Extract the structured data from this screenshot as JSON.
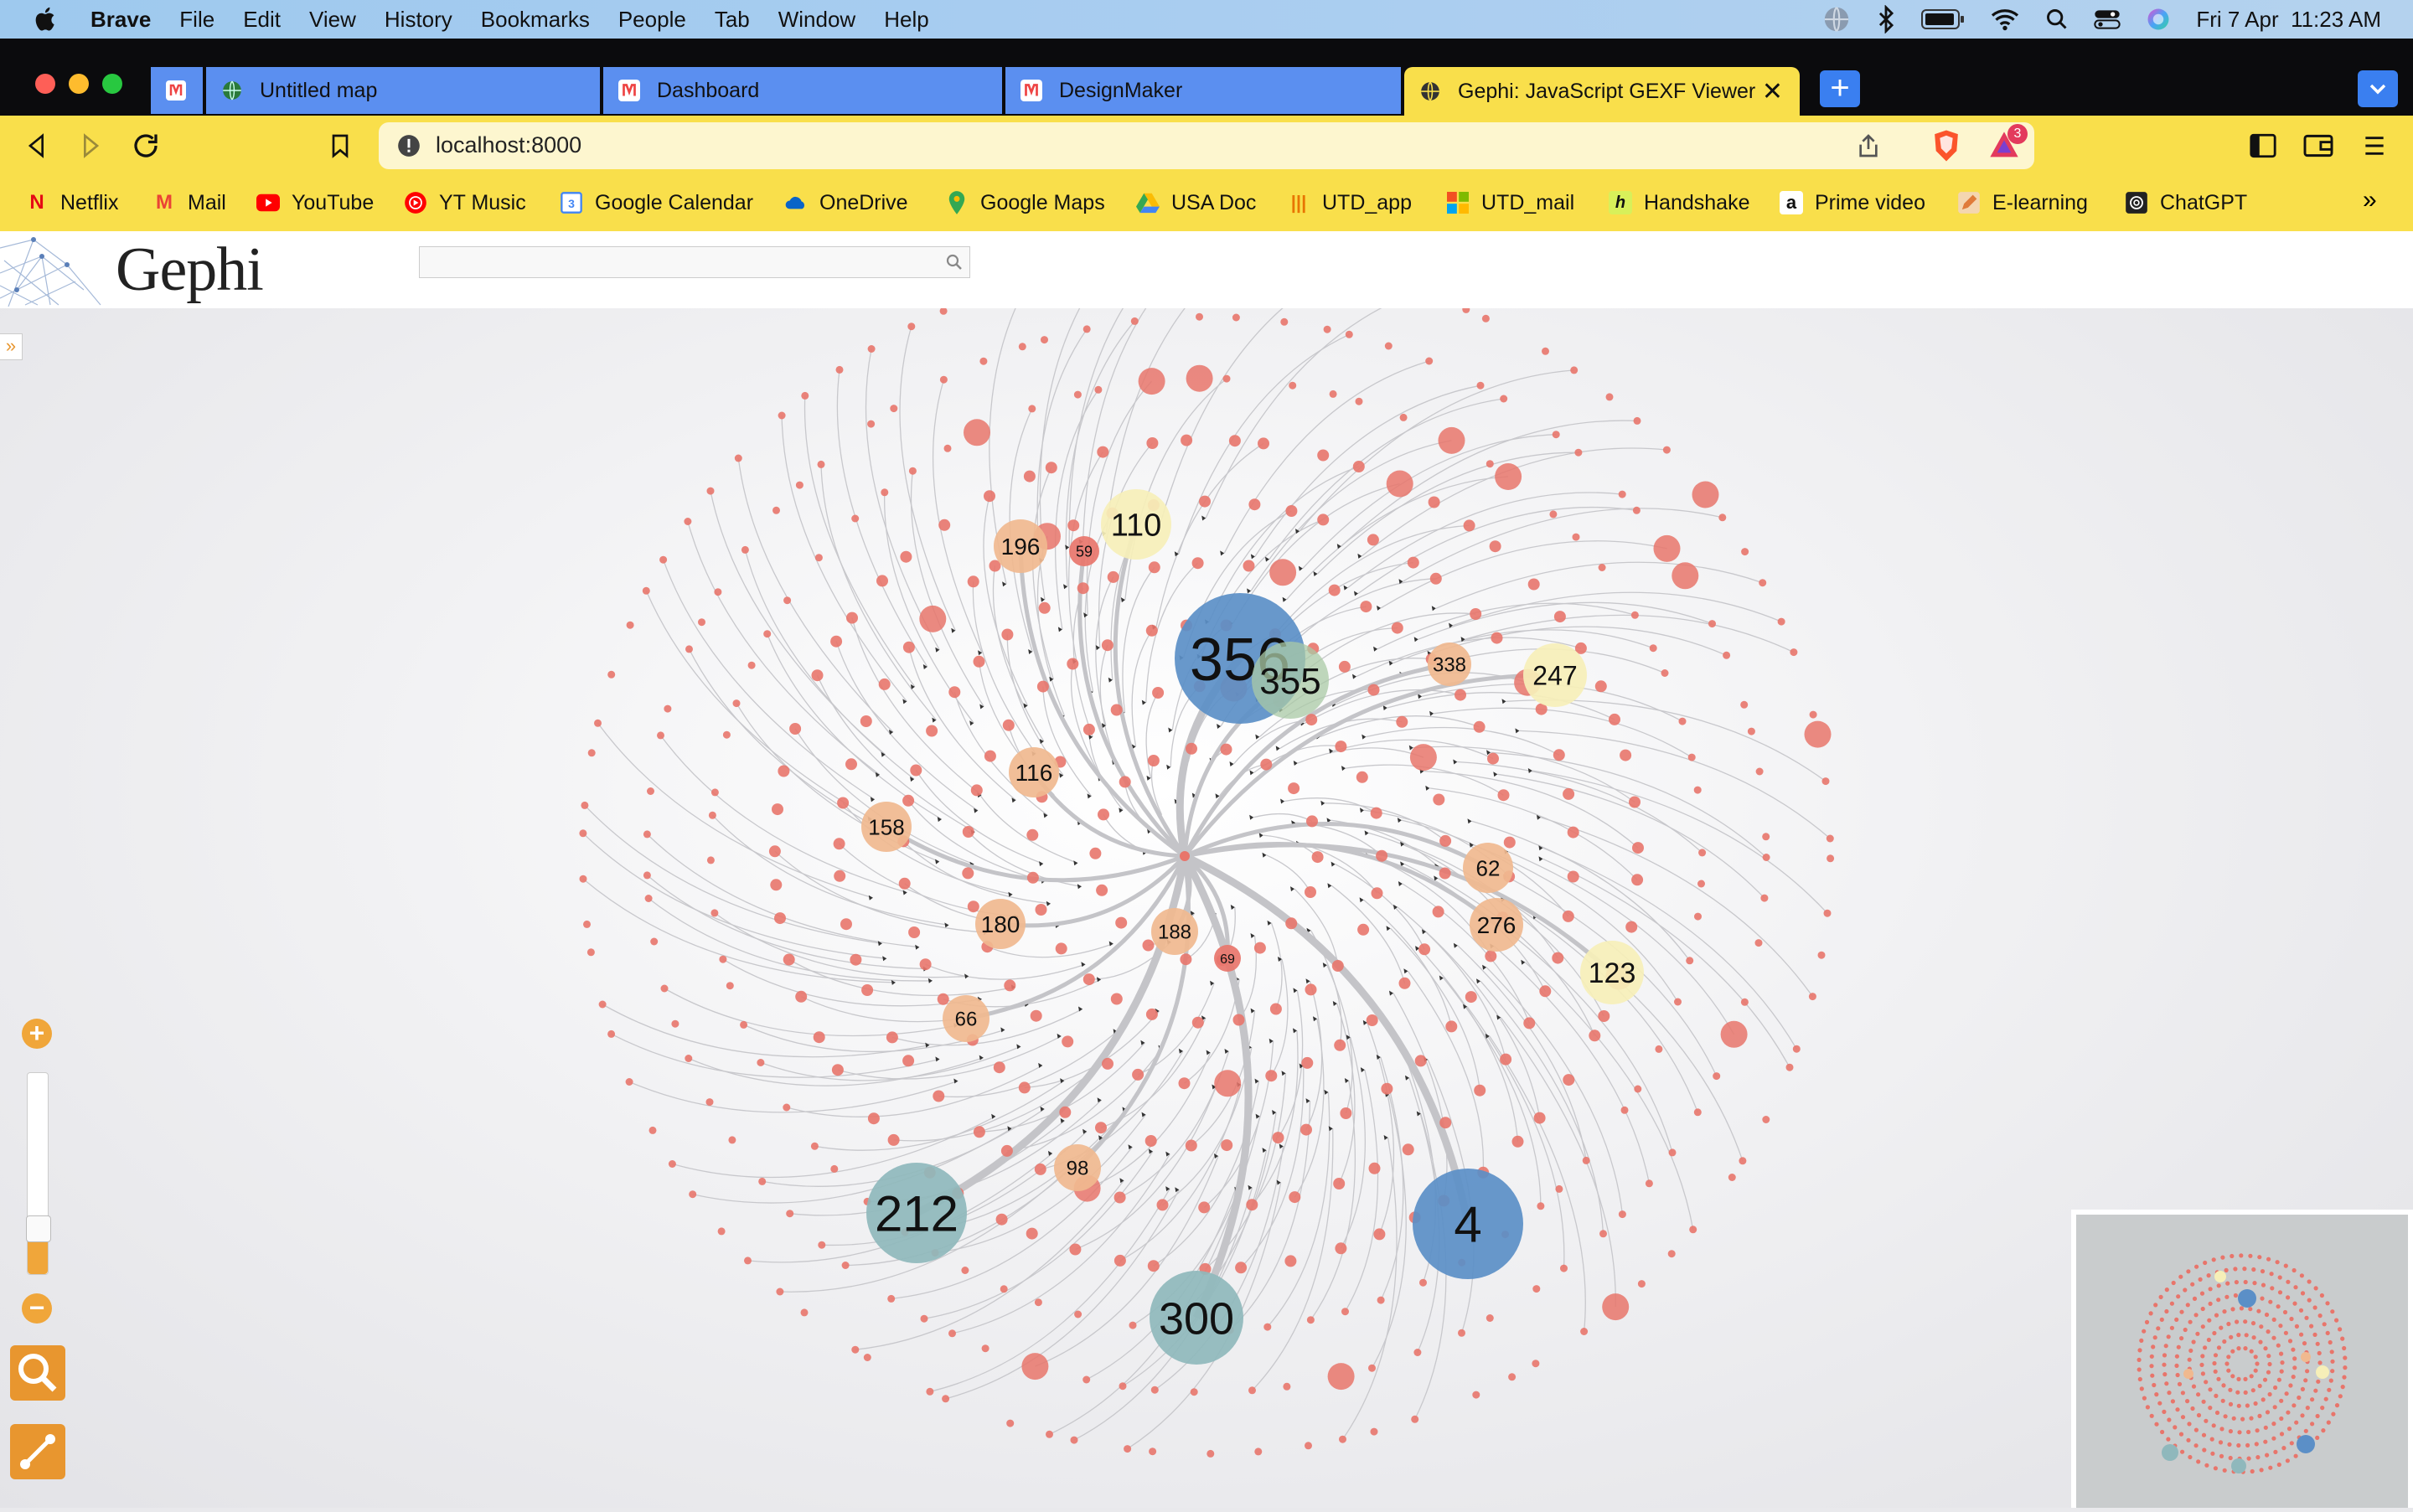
{
  "menubar": {
    "app_name": "Brave",
    "items": [
      "File",
      "Edit",
      "View",
      "History",
      "Bookmarks",
      "People",
      "Tab",
      "Window",
      "Help"
    ],
    "datetime": "Fri 7 Apr  11:23 AM"
  },
  "tabs": [
    {
      "label": "Untitled map",
      "icon": "globe-map-icon",
      "active": false
    },
    {
      "label": "Dashboard",
      "icon": "app-icon",
      "active": false
    },
    {
      "label": "DesignMaker",
      "icon": "app-icon",
      "active": false
    },
    {
      "label": "Gephi: JavaScript GEXF Viewer",
      "icon": "globe-icon",
      "active": true
    }
  ],
  "address_bar": {
    "url": "localhost:8000"
  },
  "brave_rewards_badge": "3",
  "bookmarks": [
    {
      "label": "Netflix",
      "icon": "netflix-icon",
      "color": "#e50914"
    },
    {
      "label": "Mail",
      "icon": "gmail-icon",
      "color": "#ea4335"
    },
    {
      "label": "YouTube",
      "icon": "youtube-icon",
      "color": "#ff0000"
    },
    {
      "label": "YT Music",
      "icon": "yt-music-icon",
      "color": "#ff0000"
    },
    {
      "label": "Google Calendar",
      "icon": "calendar-icon",
      "color": "#4285f4"
    },
    {
      "label": "OneDrive",
      "icon": "onedrive-icon",
      "color": "#0a64c8"
    },
    {
      "label": "Google Maps",
      "icon": "maps-icon",
      "color": "#34a853"
    },
    {
      "label": "USA Doc",
      "icon": "drive-icon",
      "color": "#fbbc04"
    },
    {
      "label": "UTD_app",
      "icon": "utd-icon",
      "color": "#e87500"
    },
    {
      "label": "UTD_mail",
      "icon": "microsoft-icon",
      "color": "#f25022"
    },
    {
      "label": "Handshake",
      "icon": "handshake-icon",
      "color": "#2e2e2e"
    },
    {
      "label": "Prime video",
      "icon": "amazon-icon",
      "color": "#111111"
    },
    {
      "label": "E-learning",
      "icon": "pencil-icon",
      "color": "#e0a060"
    },
    {
      "label": "ChatGPT",
      "icon": "chatgpt-icon",
      "color": "#333333"
    }
  ],
  "gephi": {
    "logo_text": "Gephi",
    "search": {
      "value": "",
      "placeholder": ""
    }
  },
  "graph": {
    "colors": {
      "blue": "#5b8fc7",
      "teal": "#8fb8bc",
      "green": "#a9c9a5",
      "peach": "#f0b98f",
      "cream": "#f6efb8",
      "red": "#e8756b"
    },
    "labeled_nodes": [
      {
        "label": "356",
        "color": "blue"
      },
      {
        "label": "355",
        "color": "green"
      },
      {
        "label": "110",
        "color": "cream"
      },
      {
        "label": "196",
        "color": "peach"
      },
      {
        "label": "59",
        "color": "red"
      },
      {
        "label": "338",
        "color": "peach"
      },
      {
        "label": "247",
        "color": "cream"
      },
      {
        "label": "116",
        "color": "peach"
      },
      {
        "label": "158",
        "color": "peach"
      },
      {
        "label": "62",
        "color": "peach"
      },
      {
        "label": "276",
        "color": "peach"
      },
      {
        "label": "123",
        "color": "cream"
      },
      {
        "label": "180",
        "color": "peach"
      },
      {
        "label": "188",
        "color": "peach"
      },
      {
        "label": "69",
        "color": "red"
      },
      {
        "label": "66",
        "color": "peach"
      },
      {
        "label": "98",
        "color": "peach"
      },
      {
        "label": "212",
        "color": "teal"
      },
      {
        "label": "4",
        "color": "blue"
      },
      {
        "label": "300",
        "color": "teal"
      }
    ]
  }
}
